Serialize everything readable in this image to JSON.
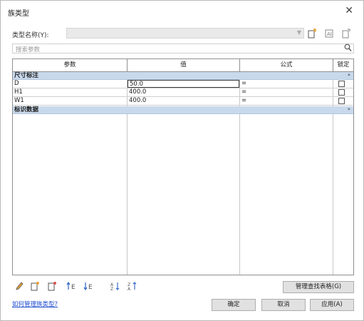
{
  "window": {
    "title": "族类型",
    "close_glyph": "✕"
  },
  "type_name": {
    "label": "类型名称(Y):",
    "value": ""
  },
  "type_toolbar": [
    "new-type-icon",
    "rename-type-icon",
    "delete-type-icon"
  ],
  "search": {
    "placeholder": "搜索参数"
  },
  "table": {
    "headers": {
      "param": "参数",
      "value": "值",
      "formula": "公式",
      "lock": "锁定"
    },
    "groups": [
      {
        "label": "尺寸标注",
        "collapse_glyph": "»",
        "rows": [
          {
            "name": "D",
            "value": "50.0",
            "formula": "=",
            "locked": false
          },
          {
            "name": "H1",
            "value": "400.0",
            "formula": "=",
            "locked": false
          },
          {
            "name": "W1",
            "value": "400.0",
            "formula": "=",
            "locked": false
          }
        ]
      },
      {
        "label": "标识数据",
        "collapse_glyph": "»",
        "rows": []
      }
    ]
  },
  "bottom_tools": [
    "edit-pencil-icon",
    "new-param-icon",
    "delete-param-icon",
    "move-up-icon",
    "move-down-icon",
    "sort-asc-icon",
    "sort-desc-icon"
  ],
  "buttons": {
    "manage_lookup": "管理查找表格(G)",
    "ok": "确定",
    "cancel": "取消",
    "apply": "应用(A)"
  },
  "help_link": "如何管理族类型?",
  "colors": {
    "group_header": "#c9d9ec",
    "link": "#1f4fcf",
    "accent_orange": "#e8a23a"
  }
}
